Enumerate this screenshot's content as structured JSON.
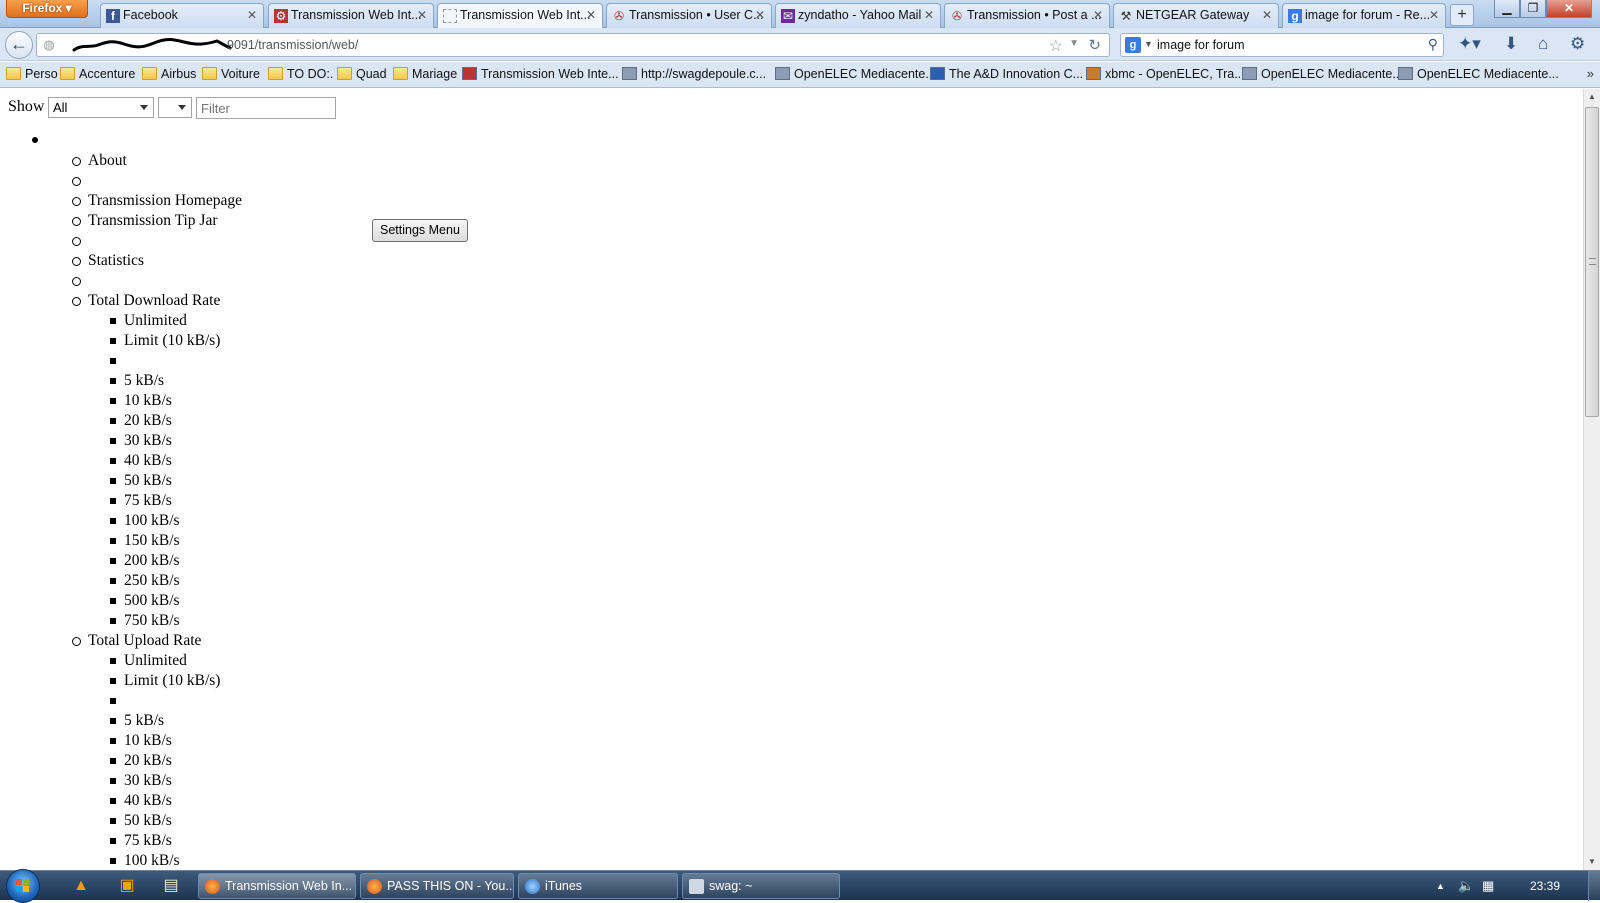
{
  "browser": {
    "app_button": "Firefox",
    "tabs": [
      {
        "label": "Facebook",
        "icon": "facebook-icon"
      },
      {
        "label": "Transmission Web Int...",
        "icon": "transmission-icon"
      },
      {
        "label": "Transmission Web Int...",
        "icon": "blank-page-icon"
      },
      {
        "label": "Transmission • User C...",
        "icon": "forum-icon"
      },
      {
        "label": "zyndatho - Yahoo Mail",
        "icon": "yahoo-mail-icon"
      },
      {
        "label": "Transmission • Post a ...",
        "icon": "forum-icon"
      },
      {
        "label": "NETGEAR Gateway",
        "icon": "tools-icon"
      },
      {
        "label": "image for forum - Re...",
        "icon": "google-icon"
      }
    ],
    "new_tab": "+",
    "window_controls": {
      "minimize": "▁",
      "restore": "❐",
      "close": "✕"
    },
    "url": "9091/transmission/web/",
    "search_engine_letter": "g",
    "search_value": "image for forum",
    "bookmarks": [
      {
        "label": "Perso",
        "type": "folder"
      },
      {
        "label": "Accenture",
        "type": "folder"
      },
      {
        "label": "Airbus",
        "type": "folder"
      },
      {
        "label": "Voiture",
        "type": "folder"
      },
      {
        "label": "TO DO:.",
        "type": "folder"
      },
      {
        "label": "Quad",
        "type": "folder"
      },
      {
        "label": "Mariage",
        "type": "folder"
      },
      {
        "label": "Transmission Web Inte...",
        "type": "page"
      },
      {
        "label": "http://swagdepoule.c...",
        "type": "page"
      },
      {
        "label": "OpenELEC Mediacente...",
        "type": "page"
      },
      {
        "label": "The A&D Innovation C...",
        "type": "page"
      },
      {
        "label": "xbmc - OpenELEC, Tra...",
        "type": "page"
      },
      {
        "label": "OpenELEC Mediacente...",
        "type": "page"
      },
      {
        "label": "OpenELEC Mediacente...",
        "type": "page"
      }
    ],
    "bookmarks_more": "»"
  },
  "page": {
    "show_label": "Show",
    "show_select_value": "All",
    "filter_placeholder": "Filter",
    "settings_menu_label": "Settings Menu",
    "menu": {
      "about": "About",
      "homepage": "Transmission Homepage",
      "tip_jar": "Transmission Tip Jar",
      "statistics": "Statistics",
      "download_rate": {
        "label": "Total Download Rate",
        "unlimited": "Unlimited",
        "limit": "Limit (10 kB/s)",
        "speeds": [
          "5 kB/s",
          "10 kB/s",
          "20 kB/s",
          "30 kB/s",
          "40 kB/s",
          "50 kB/s",
          "75 kB/s",
          "100 kB/s",
          "150 kB/s",
          "200 kB/s",
          "250 kB/s",
          "500 kB/s",
          "750 kB/s"
        ]
      },
      "upload_rate": {
        "label": "Total Upload Rate",
        "unlimited": "Unlimited",
        "limit": "Limit (10 kB/s)",
        "speeds": [
          "5 kB/s",
          "10 kB/s",
          "20 kB/s",
          "30 kB/s",
          "40 kB/s",
          "50 kB/s",
          "75 kB/s",
          "100 kB/s"
        ]
      }
    }
  },
  "taskbar": {
    "tasks": [
      {
        "label": "Transmission Web In...",
        "active": true
      },
      {
        "label": "PASS THIS ON - You...",
        "active": false
      },
      {
        "label": "iTunes",
        "active": false
      },
      {
        "label": "swag: ~",
        "active": false
      }
    ],
    "clock": "23:39"
  },
  "colors": {
    "accent": "#e0701c",
    "taskbar": "#1d3451",
    "chrome": "#dbe6f4"
  }
}
